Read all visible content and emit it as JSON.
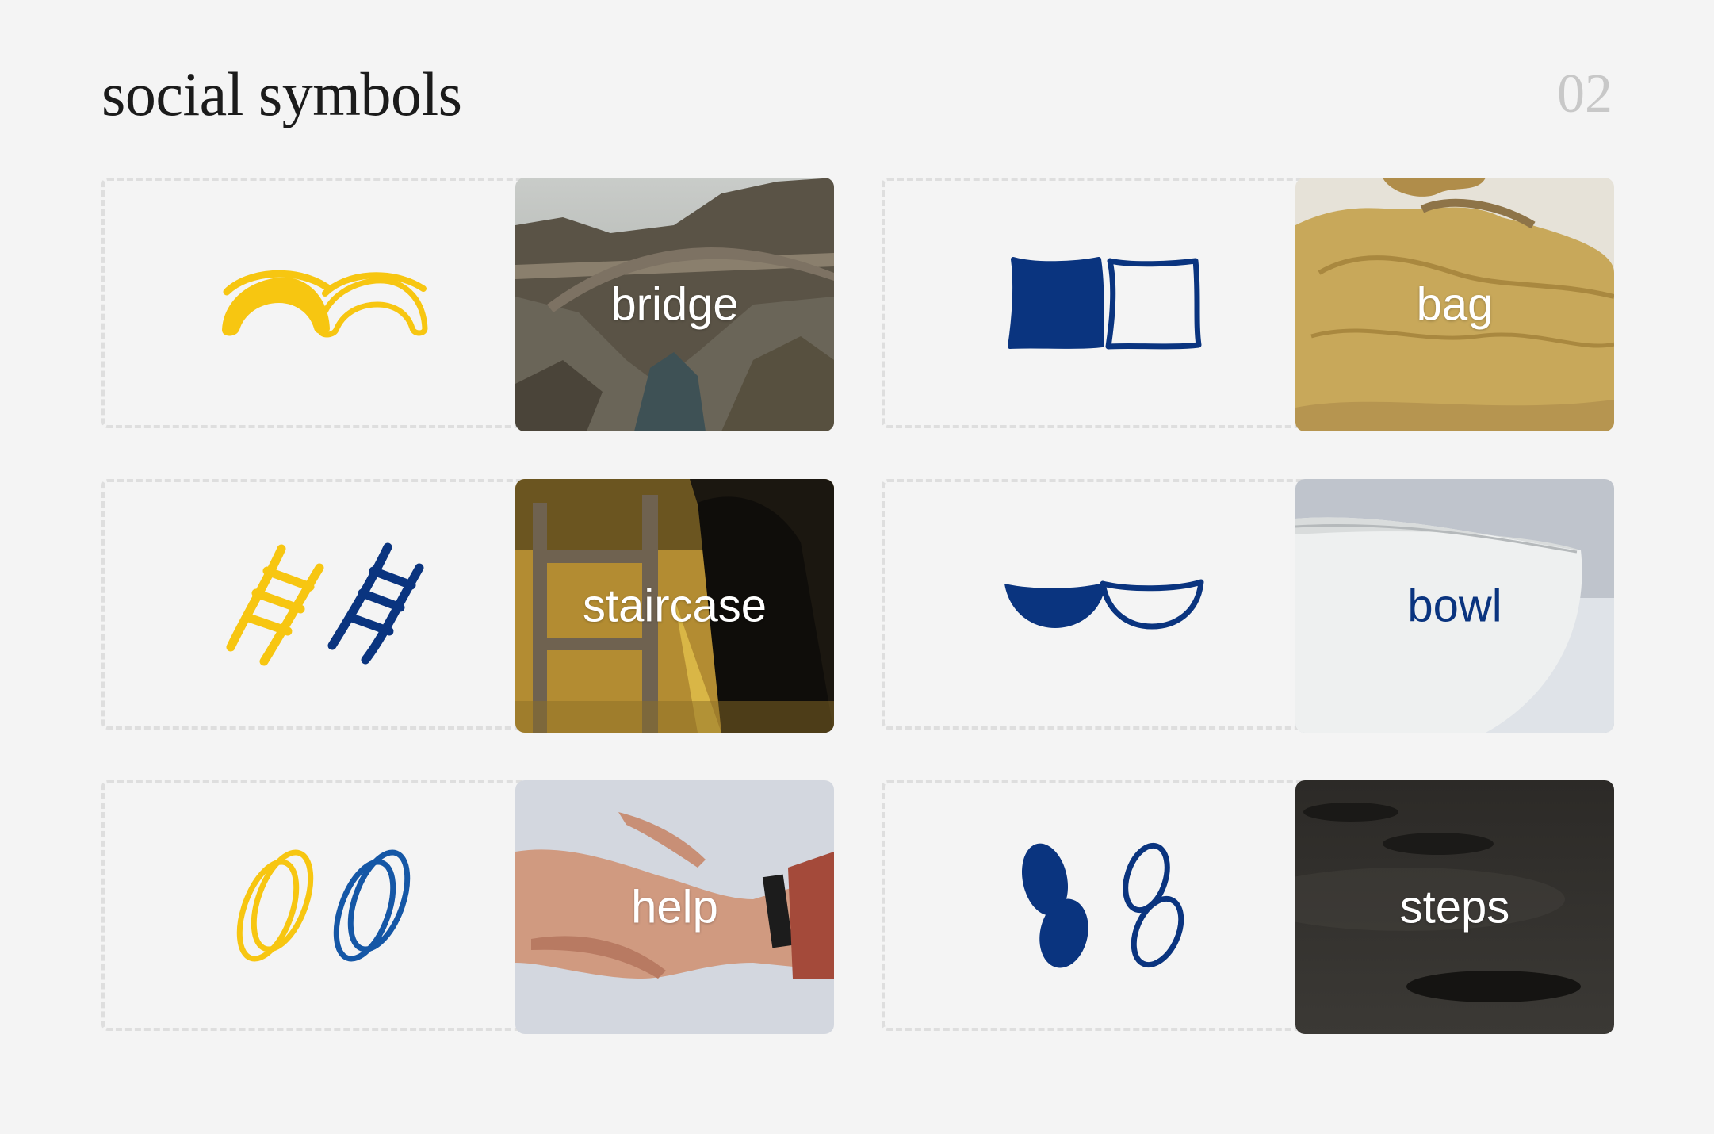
{
  "header": {
    "title": "social symbols",
    "page_number": "02"
  },
  "colors": {
    "yellow": "#f7c611",
    "navy": "#0a347f",
    "blue": "#1557a6",
    "dash": "#dedede"
  },
  "cards": [
    {
      "label": "bridge",
      "symbol": "arch",
      "symbol_color": "yellow"
    },
    {
      "label": "bag",
      "symbol": "square",
      "symbol_color": "navy"
    },
    {
      "label": "staircase",
      "symbol": "ladder",
      "symbol_color": "yellow-and-navy"
    },
    {
      "label": "bowl",
      "symbol": "bowl",
      "symbol_color": "navy"
    },
    {
      "label": "help",
      "symbol": "hands-ovals",
      "symbol_color": "yellow-and-blue"
    },
    {
      "label": "steps",
      "symbol": "footprints",
      "symbol_color": "navy"
    }
  ]
}
